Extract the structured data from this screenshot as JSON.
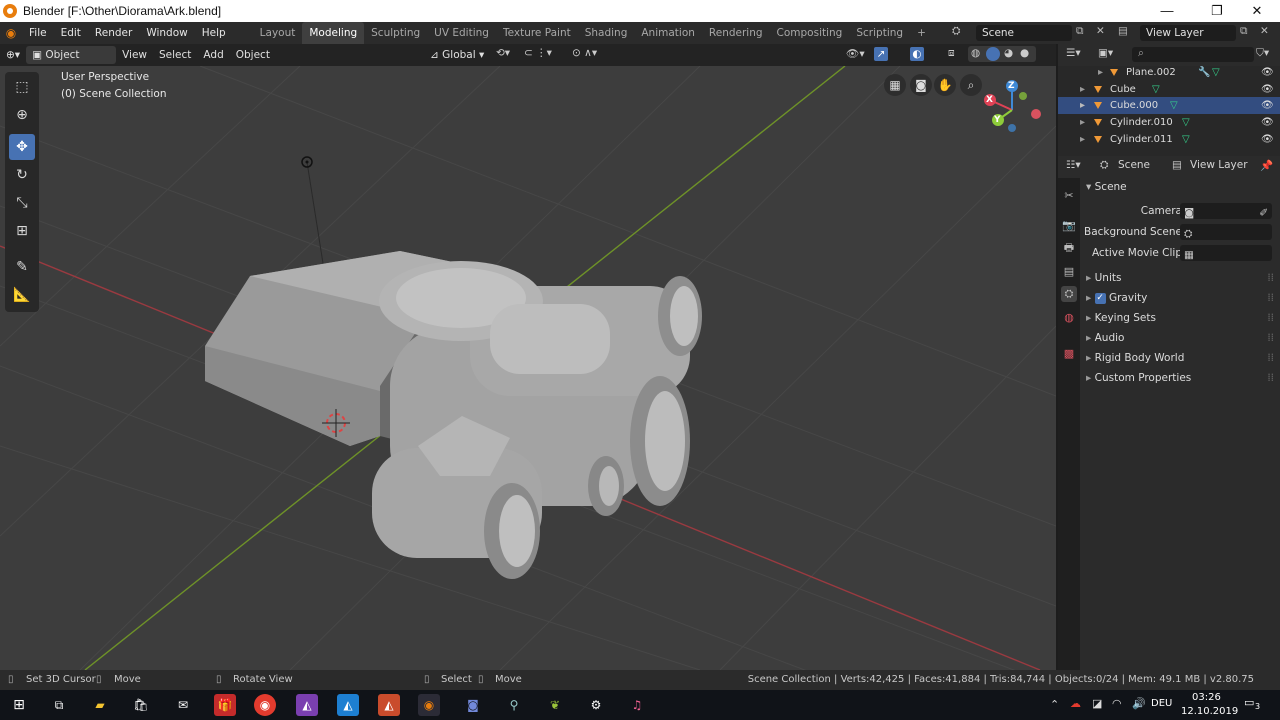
{
  "window": {
    "title": "Blender [F:\\Other\\Diorama\\Ark.blend]",
    "minimize": "—",
    "maximize": "❐",
    "close": "✕"
  },
  "menu": [
    "File",
    "Edit",
    "Render",
    "Window",
    "Help"
  ],
  "workspaces": [
    "Layout",
    "Modeling",
    "Sculpting",
    "UV Editing",
    "Texture Paint",
    "Shading",
    "Animation",
    "Rendering",
    "Compositing",
    "Scripting"
  ],
  "active_workspace": "Modeling",
  "scene_field": "Scene",
  "view_layer_field": "View Layer",
  "viewport_header": {
    "mode": "Object Mode",
    "view": "View",
    "select": "Select",
    "add": "Add",
    "object": "Object",
    "transform": "Global"
  },
  "viewport": {
    "perspective": "User Perspective",
    "collection": "(0) Scene Collection",
    "gizmo": {
      "x": "X",
      "y": "Y",
      "z": "Z"
    }
  },
  "outliner": {
    "items": [
      {
        "name": "Plane.002",
        "selected": false
      },
      {
        "name": "Cube",
        "selected": false
      },
      {
        "name": "Cube.000",
        "selected": true
      },
      {
        "name": "Cylinder.010",
        "selected": false
      },
      {
        "name": "Cylinder.011",
        "selected": false
      }
    ]
  },
  "properties": {
    "tab_scene": "Scene",
    "tab_view_layer": "View Layer",
    "panel": "Scene",
    "camera_label": "Camera",
    "background_label": "Background Scene",
    "movieclip_label": "Active Movie Clip",
    "sections": [
      "Units",
      "Gravity",
      "Keying Sets",
      "Audio",
      "Rigid Body World",
      "Custom Properties"
    ],
    "gravity_checked": true
  },
  "statusbar": {
    "left": [
      "Set 3D Cursor",
      "Move",
      "Rotate View",
      "Select",
      "Move"
    ],
    "stats": "Scene Collection | Verts:42,425 | Faces:41,884 | Tris:84,744 | Objects:0/24 | Mem: 49.1 MB | v2.80.75"
  },
  "taskbar": {
    "lang": "DEU",
    "time": "03:26",
    "date": "12.10.2019",
    "notifications": "3"
  },
  "colors": {
    "accent": "#4772b3",
    "orange": "#e87d0d",
    "x_axis": "#e04255",
    "y_axis": "#8ecc3a",
    "z_axis": "#3f8ad6"
  }
}
